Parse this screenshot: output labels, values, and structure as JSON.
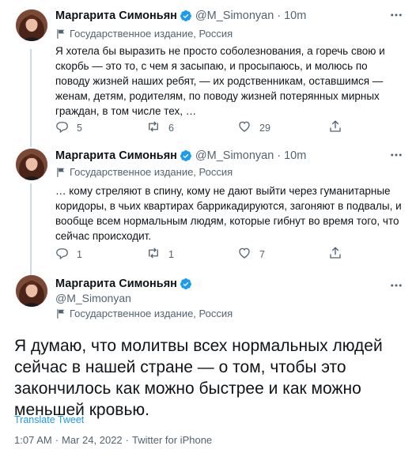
{
  "tweets": [
    {
      "name": "Маргарита Симоньян",
      "handle": "@M_Simonyan",
      "dot": "·",
      "time": "10m",
      "label": "Государственное издание, Россия",
      "text": "Я хотела бы выразить не просто соболезнования, а горечь свою и скорбь — это то, с чем я засыпаю, и просыпаюсь, и молюсь по поводу жизней наших ребят, — их родственникам, оставшимся — женам, детям, родителям, по поводу жизней потерянных мирных граждан, в том числе тех, …",
      "replies": "5",
      "retweets": "6",
      "likes": "29"
    },
    {
      "name": "Маргарита Симоньян",
      "handle": "@M_Simonyan",
      "dot": "·",
      "time": "10m",
      "label": "Государственное издание, Россия",
      "text": "… кому стреляют в спину, кому не дают выйти через гуманитарные коридоры, в чьих квартирах баррикадируются, загоняют в подвалы, и вообще всем нормальным людям, которые гибнут во время того, что сейчас происходит.",
      "replies": "1",
      "retweets": "1",
      "likes": "7"
    }
  ],
  "main_tweet": {
    "name": "Маргарита Симоньян",
    "handle": "@M_Simonyan",
    "label": "Государственное издание, Россия",
    "text": "Я думаю, что молитвы всех нормальных людей сейчас в нашей стране — о том, чтобы это закончилось как можно быстрее и как можно меньшей кровью.",
    "translate": "Translate Tweet",
    "time": "1:07 AM",
    "date": "Mar 24, 2022",
    "source": "Twitter for iPhone",
    "sep": "·"
  },
  "colors": {
    "accent": "#1d9bf0",
    "secondary_text": "#536471",
    "primary_text": "#0f1419",
    "verified": "#1d9bf0"
  },
  "icons": [
    "verified-badge-icon",
    "state-media-flag-icon",
    "reply-icon",
    "retweet-icon",
    "like-icon",
    "share-icon",
    "more-icon"
  ]
}
